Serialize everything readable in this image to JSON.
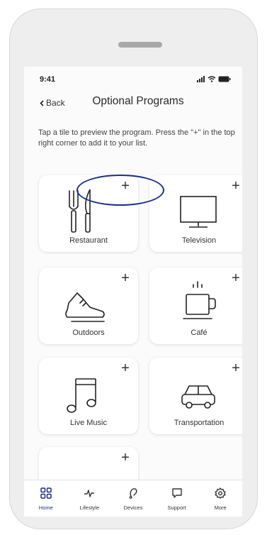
{
  "status_bar": {
    "time": "9:41"
  },
  "nav": {
    "back_label": "Back",
    "title": "Optional Programs"
  },
  "description": "Tap a tile to preview the program. Press the \"+\" in the top right corner to add it to your list.",
  "tiles": [
    {
      "label": "Restaurant",
      "icon": "restaurant-icon",
      "add": "+"
    },
    {
      "label": "Television",
      "icon": "television-icon",
      "add": "+"
    },
    {
      "label": "Outdoors",
      "icon": "shoe-icon",
      "add": "+"
    },
    {
      "label": "Café",
      "icon": "coffee-cup-icon",
      "add": "+"
    },
    {
      "label": "Live Music",
      "icon": "music-note-icon",
      "add": "+"
    },
    {
      "label": "Transportation",
      "icon": "car-icon",
      "add": "+"
    },
    {
      "label": "",
      "icon": "",
      "add": "+"
    }
  ],
  "tab_bar": {
    "active": "Home",
    "items": [
      {
        "label": "Home",
        "icon": "grid-icon"
      },
      {
        "label": "Lifestyle",
        "icon": "pulse-icon"
      },
      {
        "label": "Devices",
        "icon": "hearing-aid-icon"
      },
      {
        "label": "Support",
        "icon": "chat-bubble-icon"
      },
      {
        "label": "More",
        "icon": "gear-icon"
      }
    ]
  },
  "colors": {
    "accent": "#1c2f8a",
    "screen_bg": "#fbfbfb",
    "phone_bg": "#eeeeee"
  }
}
